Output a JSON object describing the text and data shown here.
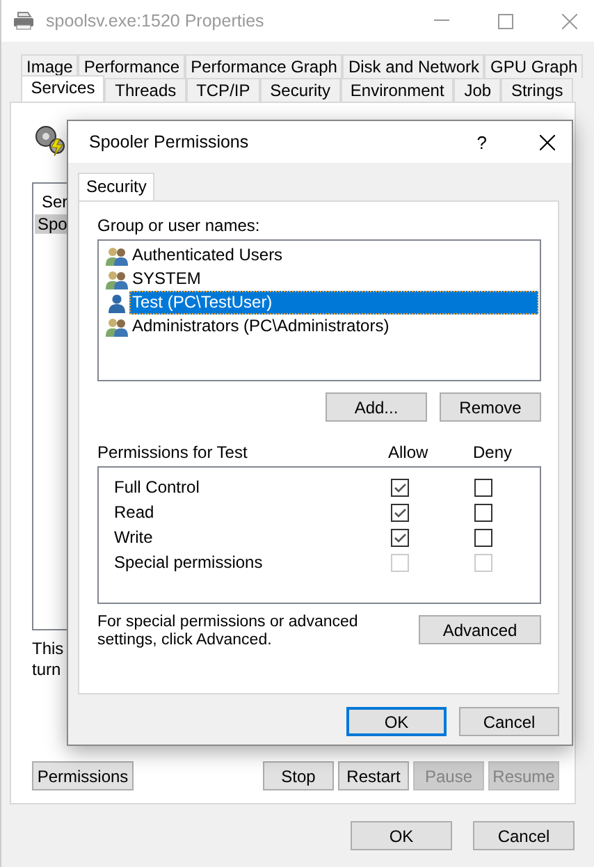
{
  "window": {
    "title": "spoolsv.exe:1520 Properties"
  },
  "tab_rows": [
    [
      {
        "label": "Image",
        "selected": false
      },
      {
        "label": "Performance",
        "selected": false
      },
      {
        "label": "Performance Graph",
        "selected": false
      },
      {
        "label": "Disk and Network",
        "selected": false
      },
      {
        "label": "GPU Graph",
        "selected": false
      }
    ],
    [
      {
        "label": "Services",
        "selected": true
      },
      {
        "label": "Threads",
        "selected": false
      },
      {
        "label": "TCP/IP",
        "selected": false
      },
      {
        "label": "Security",
        "selected": false
      },
      {
        "label": "Environment",
        "selected": false
      },
      {
        "label": "Job",
        "selected": false
      },
      {
        "label": "Strings",
        "selected": false
      }
    ]
  ],
  "services": {
    "list_header": "Ser",
    "items": [
      {
        "label": "Spo",
        "selected": true
      }
    ],
    "description_lines": [
      "This",
      "turn"
    ],
    "buttons": [
      {
        "label": "Permissions",
        "disabled": false
      },
      {
        "label": "Stop",
        "disabled": false
      },
      {
        "label": "Restart",
        "disabled": false
      },
      {
        "label": "Pause",
        "disabled": true
      },
      {
        "label": "Resume",
        "disabled": true
      }
    ]
  },
  "buttons": [
    {
      "label": "OK"
    },
    {
      "label": "Cancel"
    }
  ],
  "dialog": {
    "title": "Spooler Permissions",
    "help": "?",
    "tabs": [
      {
        "label": "Security",
        "selected": true
      }
    ],
    "group_label": "Group or user names:",
    "principals": [
      {
        "name": "Authenticated Users",
        "kind": "group",
        "selected": false
      },
      {
        "name": "SYSTEM",
        "kind": "group",
        "selected": false
      },
      {
        "name": "Test (PC\\TestUser)",
        "kind": "user",
        "selected": true
      },
      {
        "name": "Administrators (PC\\Administrators)",
        "kind": "group",
        "selected": false
      }
    ],
    "principal_buttons": [
      "Add...",
      "Remove"
    ],
    "permissions_label": "Permissions for Test",
    "columns": [
      "Allow",
      "Deny"
    ],
    "permissions": [
      {
        "name": "Full Control",
        "allow": {
          "checked": true,
          "disabled": false
        },
        "deny": {
          "checked": false,
          "disabled": false
        }
      },
      {
        "name": "Read",
        "allow": {
          "checked": true,
          "disabled": false
        },
        "deny": {
          "checked": false,
          "disabled": false
        }
      },
      {
        "name": "Write",
        "allow": {
          "checked": true,
          "disabled": false
        },
        "deny": {
          "checked": false,
          "disabled": false
        }
      },
      {
        "name": "Special permissions",
        "allow": {
          "checked": false,
          "disabled": true
        },
        "deny": {
          "checked": false,
          "disabled": true
        }
      }
    ],
    "advanced_note": "For special permissions or advanced settings, click Advanced.",
    "advanced_button": "Advanced",
    "buttons": [
      {
        "label": "OK",
        "default": true
      },
      {
        "label": "Cancel",
        "default": false
      }
    ]
  }
}
